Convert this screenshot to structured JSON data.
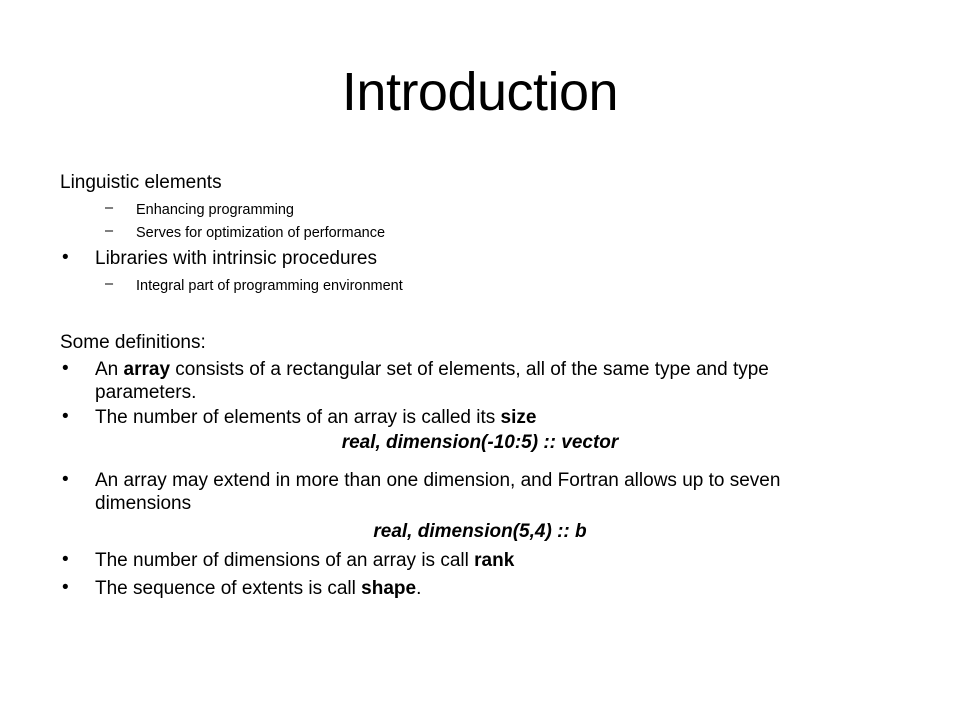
{
  "slide": {
    "title": "Introduction",
    "sections": {
      "intro_heading": "Linguistic elements",
      "intro_subitems": [
        "Enhancing programming",
        "Serves for optimization of performance"
      ],
      "libraries_bullet": "Libraries with intrinsic procedures",
      "libraries_subitems": [
        "Integral part of programming environment"
      ],
      "definitions_heading": "Some definitions:",
      "definitions": {
        "array": {
          "pre": "An ",
          "bold": "array",
          "post": " consists of a rectangular set of elements, all of the same type and type",
          "cont": "parameters."
        },
        "size": {
          "pre": "The number of elements of an array is called its ",
          "bold": "size"
        },
        "code_vector": "real, dimension(-10:5) :: vector",
        "extend": {
          "text": "An array may extend in more than one dimension, and Fortran allows up to seven",
          "cont": "dimensions"
        },
        "code_b": "real, dimension(5,4) :: b",
        "rank": {
          "pre": "The number of dimensions of an array is call ",
          "bold": "rank"
        },
        "shape": {
          "pre": "The sequence of extents is call ",
          "bold": "shape",
          "post": "."
        }
      }
    },
    "bullet_glyph": "•",
    "dash_glyph": "–"
  }
}
